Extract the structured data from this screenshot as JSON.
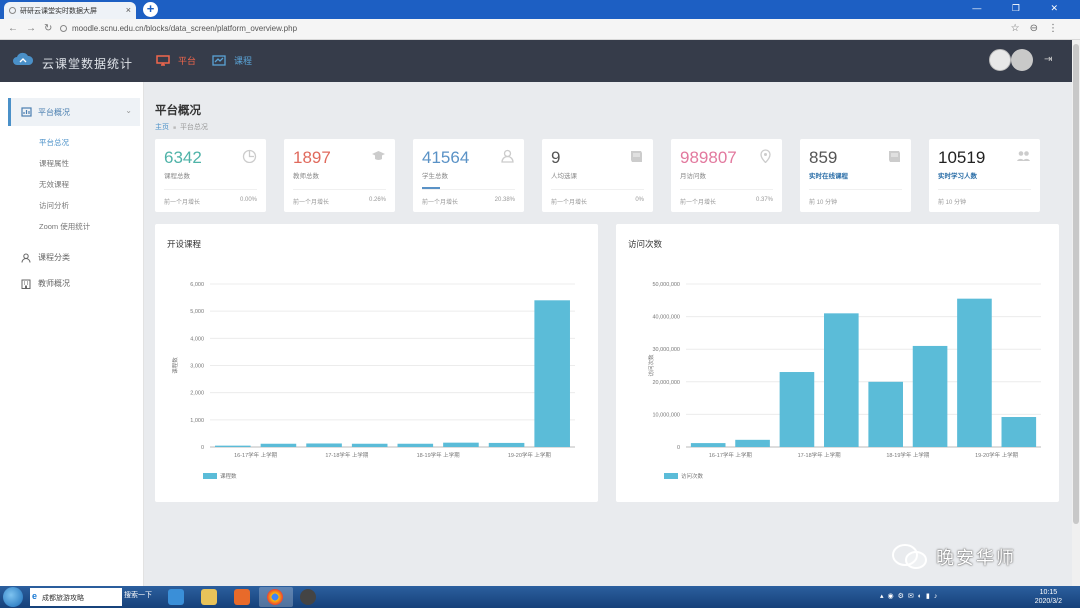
{
  "browser": {
    "tab_title": "研研云课堂实时数据大屏",
    "tab_close": "×",
    "new_tab": "+",
    "url": "moodle.scnu.edu.cn/blocks/data_screen/platform_overview.php"
  },
  "header": {
    "brand": "云课堂数据统计",
    "nav": [
      {
        "label": "平台",
        "icon": "monitor-icon",
        "active": true
      },
      {
        "label": "课程",
        "icon": "chart-line-icon",
        "active": false
      }
    ]
  },
  "sidebar": {
    "group": {
      "label": "平台概况",
      "icon": "platform-icon"
    },
    "sub_items": [
      "平台总况",
      "课程属性",
      "无效课程",
      "访问分析",
      "Zoom 使用统计"
    ],
    "active_sub": "平台总况",
    "items": [
      {
        "label": "课程分类",
        "icon": "user-icon"
      },
      {
        "label": "教师概况",
        "icon": "building-icon"
      }
    ]
  },
  "page": {
    "title": "平台概况",
    "breadcrumb_home": "主页",
    "breadcrumb_sep": "■",
    "breadcrumb_current": "平台总况"
  },
  "stats": [
    {
      "value": "6342",
      "label": "课程总数",
      "icon": "clock-icon",
      "color": "#4fb3a8",
      "footer": "前一个月增长",
      "pct": "0.00%",
      "bar": false
    },
    {
      "value": "1897",
      "label": "教师总数",
      "icon": "graduation-cap-icon",
      "color": "#e06a5d",
      "footer": "前一个月增长",
      "pct": "0.26%",
      "bar": false
    },
    {
      "value": "41564",
      "label": "学生总数",
      "icon": "user-icon",
      "color": "#5a92c6",
      "footer": "前一个月增长",
      "pct": "20.38%",
      "bar": true
    },
    {
      "value": "9",
      "label": "人均选课",
      "icon": "book-icon",
      "color": "#555555",
      "footer": "前一个月增长",
      "pct": "0%",
      "bar": false
    },
    {
      "value": "989807",
      "label": "月访问数",
      "icon": "map-pin-icon",
      "color": "#e2799e",
      "footer": "前一个月增长",
      "pct": "0.37%",
      "bar": false
    },
    {
      "value": "859",
      "label": "实时在线课程",
      "icon": "book-icon",
      "color": "#555555",
      "footer": "前 10 分钟",
      "pct": "",
      "bar": false,
      "label_blue": true
    },
    {
      "value": "10519",
      "label": "实时学习人数",
      "icon": "users-icon",
      "color": "#222222",
      "footer": "前 10 分钟",
      "pct": "",
      "bar": false,
      "label_blue": true
    }
  ],
  "chart_data": [
    {
      "type": "bar",
      "title": "开设课程",
      "ylabel": "课程数",
      "categories": [
        "16-17学年上学期",
        "16-17学年下学期",
        "17-18学年上学期",
        "17-18学年下学期",
        "18-19学年上学期",
        "18-19学年下学期",
        "19-20学年上学期",
        "19-20学年下学期"
      ],
      "tick_labels": [
        "16-17学年 上学期",
        "17-18学年 上学期",
        "18-19学年 上学期",
        "19-20学年 上学期"
      ],
      "series": [
        {
          "name": "课程数",
          "values": [
            50,
            120,
            130,
            120,
            120,
            160,
            150,
            5400
          ]
        }
      ],
      "ylim": [
        0,
        6000
      ],
      "yticks": [
        0,
        1000,
        2000,
        3000,
        4000,
        5000,
        6000
      ],
      "ytick_labels": [
        "0",
        "1,000",
        "2,000",
        "3,000",
        "4,000",
        "5,000",
        "6,000"
      ],
      "color": "#5bbcd8",
      "legend": "bottom-left",
      "grid": true
    },
    {
      "type": "bar",
      "title": "访问次数",
      "ylabel": "访问次数",
      "categories": [
        "16-17学年上学期",
        "16-17学年下学期",
        "17-18学年上学期",
        "17-18学年下学期",
        "18-19学年上学期",
        "18-19学年下学期",
        "19-20学年上学期",
        "19-20学年下学期"
      ],
      "tick_labels": [
        "16-17学年 上学期",
        "17-18学年 上学期",
        "18-19学年 上学期",
        "19-20学年 上学期"
      ],
      "series": [
        {
          "name": "访问次数",
          "values": [
            1200000,
            2200000,
            23000000,
            41000000,
            20000000,
            31000000,
            45500000,
            9200000
          ]
        }
      ],
      "ylim": [
        0,
        50000000
      ],
      "yticks": [
        0,
        10000000,
        20000000,
        30000000,
        40000000,
        50000000
      ],
      "ytick_labels": [
        "0",
        "10,000,000",
        "20,000,000",
        "30,000,000",
        "40,000,000",
        "50,000,000"
      ],
      "color": "#5bbcd8",
      "legend": "bottom-left",
      "grid": true
    }
  ],
  "watermark": "晚安华师",
  "taskbar": {
    "search_text": "成都旅游攻略",
    "search_button": "搜索一下",
    "time": "10:15",
    "date": "2020/3/2"
  }
}
